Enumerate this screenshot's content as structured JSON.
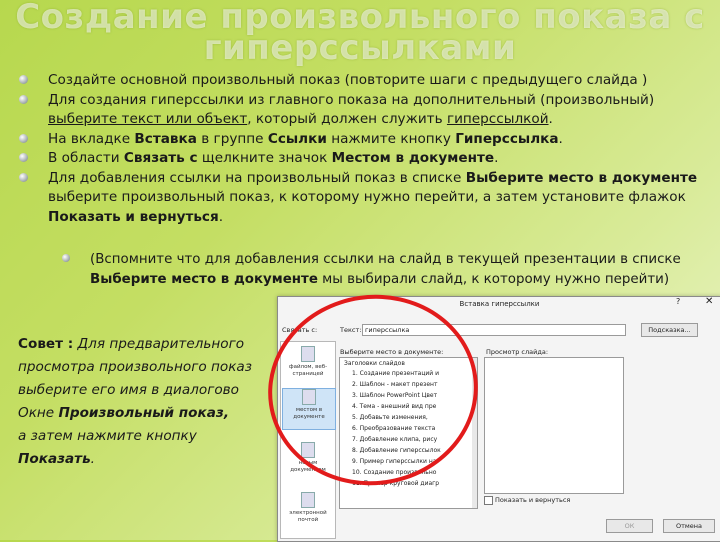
{
  "slide": {
    "title_line1": "Создание произвольного показа с",
    "title_line2": "гиперссылками"
  },
  "bullets": {
    "b1": "Создайте основной произвольный показ (повторите шаги с  предыдущего слайда )",
    "b2_a": "Для создания гиперссылки из главного показа на дополнительный (произвольный)",
    "b2_b": "выберите текст или объект",
    "b2_c": ", который должен служить ",
    "b2_d": "гиперссылкой",
    "b2_e": ".",
    "b3_a": "На вкладке ",
    "b3_b": "Вставка",
    "b3_c": " в группе ",
    "b3_d": "Ссылки",
    "b3_e": " нажмите кнопку ",
    "b3_f": "Гиперссылка",
    "b3_g": ".",
    "b4_a": "В области ",
    "b4_b": "Связать с",
    "b4_c": " щелкните значок ",
    "b4_d": "Местом в документе",
    "b4_e": ".",
    "b5_a": "Для добавления ссылки на произвольный показ в списке ",
    "b5_b": "Выберите место в документе",
    "b5_c": " выберите произвольный показ, к которому нужно перейти, а затем установите флажок ",
    "b5_d": "Показать и вернуться",
    "b5_e": ".",
    "sub_a": "(Вспомните что для добавления ссылки на слайд в текущей презентации в списке ",
    "sub_b": "Выберите место в документе",
    "sub_c": "  мы выбирали слайд, к которому нужно перейти)"
  },
  "tip": {
    "label": "Совет :",
    "l1": " Для предварительного",
    "l2": "просмотра произвольного показ",
    "l3": "выберите его имя в диалогово",
    "l4a": "Окне ",
    "l4b": "Произвольный показ,",
    "l5": " а затем нажмите кнопку",
    "l6a": " Показать",
    "l6b": "."
  },
  "dialog": {
    "title": "Вставка гиперссылки",
    "help": "?",
    "close": "✕",
    "link_to_label": "Связать с:",
    "text_label": "Текст:",
    "text_value": "гиперссылка",
    "hint_button": "Подсказка...",
    "place_label": "Выберите место в документе:",
    "preview_label": "Просмотр слайда:",
    "panel_items": [
      "файлом, веб-страницей",
      "местом в документе",
      "новым документом",
      "электронной почтой"
    ],
    "tree_root": "Заголовки слайдов",
    "tree_items": [
      "1. Создание презентаций и",
      "2. Шаблон - макет презент",
      "3. Шаблон PowerPoint Цвет",
      "4. Тема - внешний вид пре",
      "5. Добавьте изменения,",
      "6. Преобразование текста",
      "7. Добавление клипа, рису",
      "8. Добавление гиперссылок",
      "9. Пример гиперссылки на",
      "10. Создание произвольно",
      "11. Пример круговой диагр"
    ],
    "show_return_label": "Показать и вернуться",
    "ok_button": "ОК",
    "cancel_button": "Отмена"
  }
}
